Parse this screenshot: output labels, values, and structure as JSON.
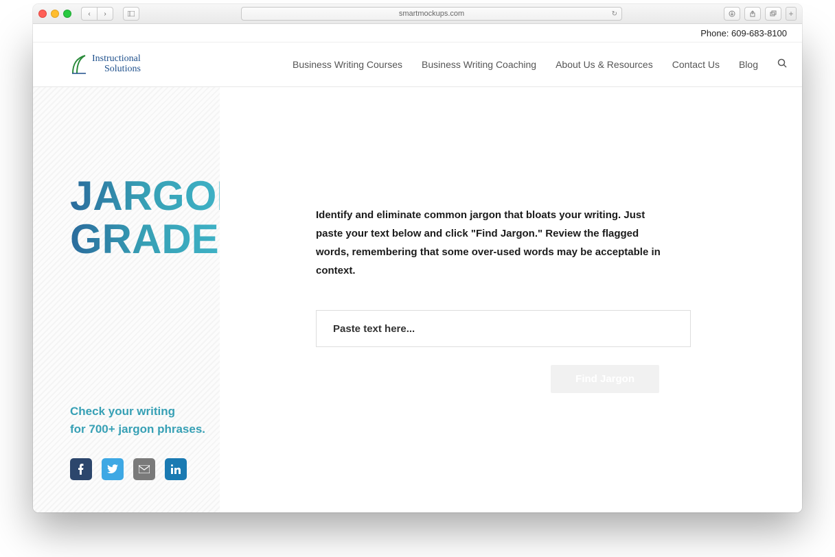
{
  "browser": {
    "address": "smartmockups.com"
  },
  "topbar": {
    "phone_label": "Phone: 609-683-8100"
  },
  "logo": {
    "line1": "Instructional",
    "line2": "Solutions"
  },
  "nav": {
    "items": [
      "Business Writing Courses",
      "Business Writing Coaching",
      "About Us & Resources",
      "Contact Us",
      "Blog"
    ]
  },
  "hero": {
    "title_line1": "JARGON",
    "title_line2": "GRADER",
    "subtitle_line1": "Check your writing",
    "subtitle_line2": "for 700+ jargon phrases."
  },
  "main": {
    "description": "Identify and eliminate common jargon that bloats your writing. Just paste your text below and click \"Find Jargon.\" Review the flagged words, remembering that some over-used words may be acceptable in context.",
    "input_placeholder": "Paste text here...",
    "button_label": "Find Jargon"
  }
}
